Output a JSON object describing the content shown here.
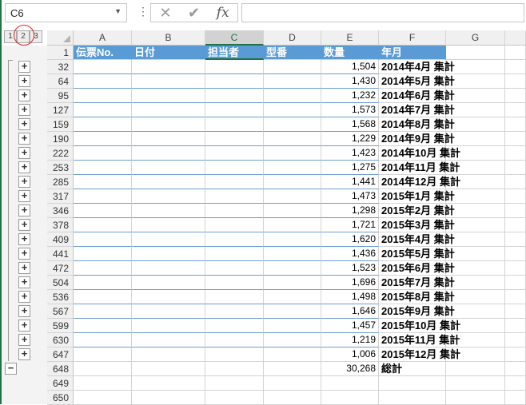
{
  "name_box": "C6",
  "formula_bar": {
    "cancel_icon": "x-icon",
    "enter_icon": "check-icon",
    "fx_label": "fx",
    "value": ""
  },
  "outline_levels": [
    "1",
    "2",
    "3"
  ],
  "selected_level": "2",
  "columns": [
    "A",
    "B",
    "C",
    "D",
    "E",
    "F",
    "G"
  ],
  "selected_column": "C",
  "header_row": {
    "row": "1",
    "cells": [
      "伝票No.",
      "日付",
      "担当者",
      "型番",
      "数量",
      "年月"
    ]
  },
  "rows": [
    {
      "row": "32",
      "qty": "1,504",
      "month": "2014年4月 集計"
    },
    {
      "row": "64",
      "qty": "1,430",
      "month": "2014年5月 集計"
    },
    {
      "row": "95",
      "qty": "1,232",
      "month": "2014年6月 集計"
    },
    {
      "row": "127",
      "qty": "1,573",
      "month": "2014年7月 集計"
    },
    {
      "row": "159",
      "qty": "1,568",
      "month": "2014年8月 集計"
    },
    {
      "row": "190",
      "qty": "1,229",
      "month": "2014年9月 集計"
    },
    {
      "row": "222",
      "qty": "1,423",
      "month": "2014年10月 集計"
    },
    {
      "row": "253",
      "qty": "1,275",
      "month": "2014年11月 集計"
    },
    {
      "row": "285",
      "qty": "1,441",
      "month": "2014年12月 集計"
    },
    {
      "row": "317",
      "qty": "1,473",
      "month": "2015年1月 集計"
    },
    {
      "row": "346",
      "qty": "1,298",
      "month": "2015年2月 集計"
    },
    {
      "row": "378",
      "qty": "1,721",
      "month": "2015年3月 集計"
    },
    {
      "row": "409",
      "qty": "1,620",
      "month": "2015年4月 集計"
    },
    {
      "row": "441",
      "qty": "1,436",
      "month": "2015年5月 集計"
    },
    {
      "row": "472",
      "qty": "1,523",
      "month": "2015年6月 集計"
    },
    {
      "row": "504",
      "qty": "1,696",
      "month": "2015年7月 集計"
    },
    {
      "row": "536",
      "qty": "1,498",
      "month": "2015年8月 集計"
    },
    {
      "row": "567",
      "qty": "1,646",
      "month": "2015年9月 集計"
    },
    {
      "row": "599",
      "qty": "1,457",
      "month": "2015年10月 集計"
    },
    {
      "row": "630",
      "qty": "1,219",
      "month": "2015年11月 集計"
    },
    {
      "row": "647",
      "qty": "1,006",
      "month": "2015年12月 集計"
    },
    {
      "row": "648",
      "qty": "30,268",
      "month": "総計"
    },
    {
      "row": "649",
      "qty": "",
      "month": ""
    },
    {
      "row": "650",
      "qty": "",
      "month": ""
    }
  ],
  "colors": {
    "header_fill": "#5b9bd5",
    "accent": "#217346",
    "highlight_circle": "#e02020"
  }
}
